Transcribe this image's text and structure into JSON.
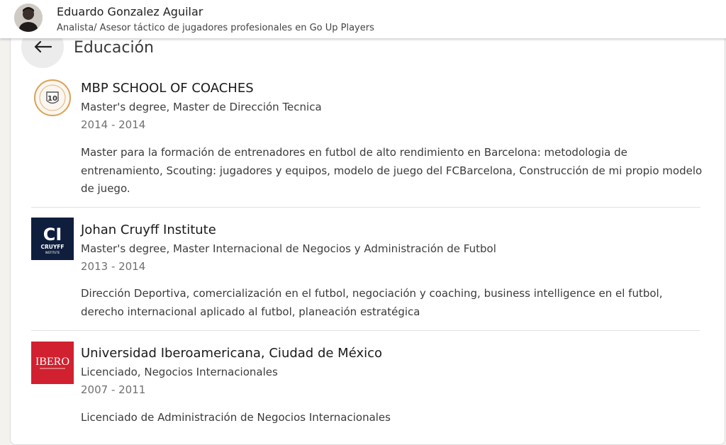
{
  "header": {
    "name": "Eduardo Gonzalez Aguilar",
    "headline": "Analista/ Asesor táctico de jugadores profesionales en Go Up Players"
  },
  "section": {
    "title": "Educación",
    "back_icon": "arrow-left-icon"
  },
  "education": [
    {
      "school": "MBP SCHOOL OF COACHES",
      "degree": "Master's degree, Master de Dirección Tecnica",
      "dates": "2014 - 2014",
      "description": "Master para la formación de entrenadores en futbol de alto rendimiento en Barcelona: metodologia de entrenamiento, Scouting: jugadores y equipos, modelo de juego del FCBarcelona, Construcción de mi propio modelo de juego.",
      "logo_badge": "10",
      "logo_color": "#d9a25a"
    },
    {
      "school": "Johan Cruyff Institute",
      "degree": "Master's degree, Master Internacional de Negocios y Administración de Futbol",
      "dates": "2013 - 2014",
      "description": "Dirección Deportiva, comercialización en el futbol, negociación y coaching, business intelligence en el futbol, derecho internacional aplicado al futbol, planeación estratégica",
      "logo_mark": "CI",
      "logo_text": "CRUYFF",
      "logo_sub": "INSTITUTE",
      "logo_color": "#0f1e3d"
    },
    {
      "school": "Universidad Iberoamericana, Ciudad de México",
      "degree": "Licenciado, Negocios Internacionales",
      "dates": "2007 - 2011",
      "description": "Licenciado de Administración de Negocios Internacionales",
      "logo_text": "IBERO",
      "logo_color": "#d1202f"
    }
  ]
}
